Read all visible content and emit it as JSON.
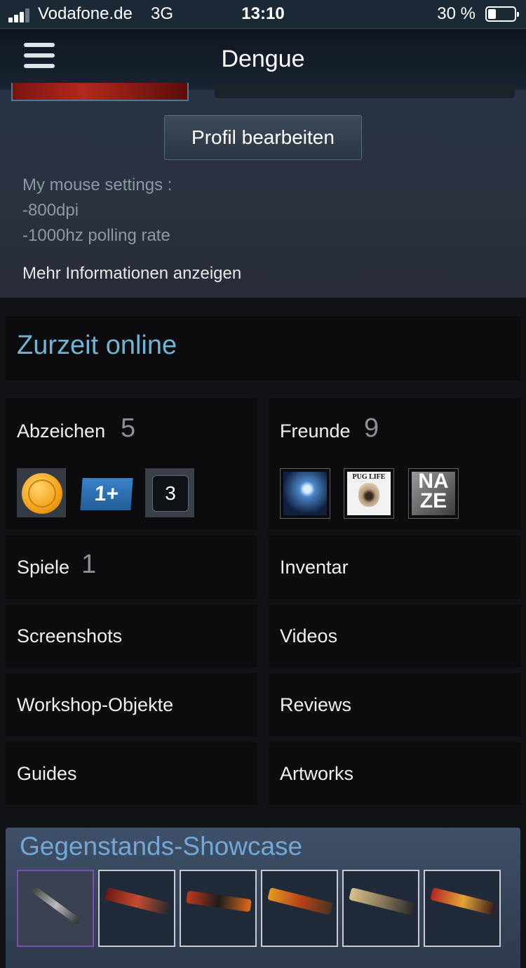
{
  "status_bar": {
    "carrier": "Vodafone.de",
    "network": "3G",
    "time": "13:10",
    "battery_percent": "30 %",
    "battery_level": 0.3,
    "signal_bars_active": 3
  },
  "nav": {
    "title": "Dengue",
    "menu_icon": "hamburger-menu-icon"
  },
  "profile": {
    "edit_button": "Profil bearbeiten",
    "summary_lines": [
      "My mouse settings :",
      "-800dpi",
      "-1000hz polling rate"
    ],
    "more_info_link": "Mehr Informationen anzeigen"
  },
  "status": {
    "online_text": "Zurzeit online"
  },
  "tiles": {
    "badges": {
      "label": "Abzeichen",
      "count": "5",
      "years_badge_value": "3",
      "xp_badge_text": "1+"
    },
    "friends": {
      "label": "Freunde",
      "count": "9",
      "friend_2_caption": "PUG LIFE",
      "friend_3_caption": "NA ZE"
    },
    "games": {
      "label": "Spiele",
      "count": "1"
    },
    "inventory": {
      "label": "Inventar"
    },
    "screenshots": {
      "label": "Screenshots"
    },
    "videos": {
      "label": "Videos"
    },
    "workshop": {
      "label": "Workshop-Objekte"
    },
    "reviews": {
      "label": "Reviews"
    },
    "guides": {
      "label": "Guides"
    },
    "artworks": {
      "label": "Artworks"
    }
  },
  "showcase": {
    "title": "Gegenstands-Showcase",
    "item_count": 6
  },
  "colors": {
    "accent_online": "#6fb6d6",
    "showcase_title": "#73a8d6",
    "tile_background": "#0c0c0e",
    "nav_background": "#182432"
  }
}
